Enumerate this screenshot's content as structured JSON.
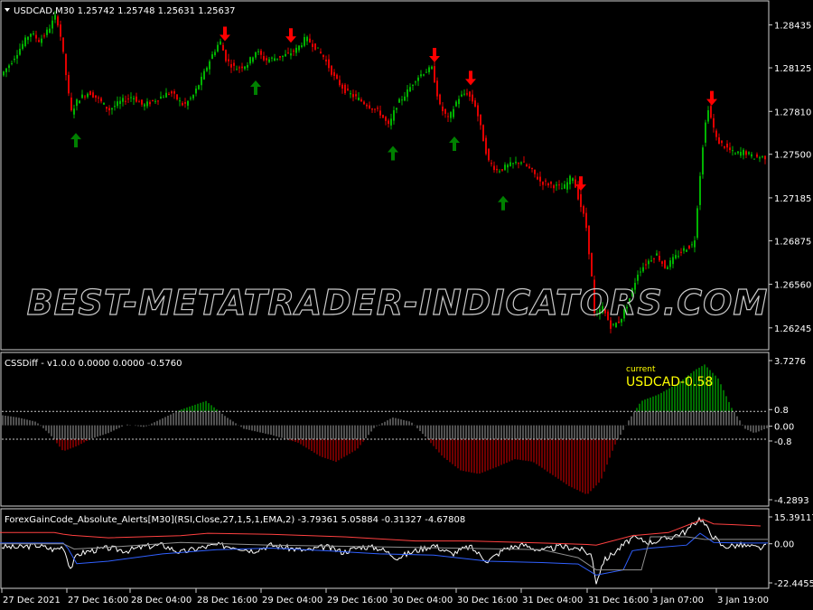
{
  "main_panel": {
    "symbol_header": "USDCAD,M30  1.25742 1.25748 1.25631 1.25637",
    "price_ticks": [
      "1.28435",
      "1.28125",
      "1.27810",
      "1.27500",
      "1.27185",
      "1.26875",
      "1.26560",
      "1.26245"
    ],
    "watermark": "BEST-METATRADER-INDICATORS.COM"
  },
  "cssdiff_panel": {
    "header": "CSSDiff - v1.0.0 0.0000 0.0000 -0.5760",
    "ticks": [
      "3.7276",
      "0.8",
      "0.00",
      "-0.8",
      "-4.2893"
    ],
    "current_caption": "current",
    "current_value": "USDCAD-0.58"
  },
  "alerts_panel": {
    "header": "ForexGainCode_Absolute_Alerts[M30](RSI,Close,27,1,5,1,EMA,2) -3.79361 5.05884 -0.31327 -4.67808",
    "ticks": [
      "15.39117",
      "0.00",
      "-22.4455"
    ]
  },
  "time_axis": [
    "27 Dec 2021",
    "27 Dec 16:00",
    "28 Dec 04:00",
    "28 Dec 16:00",
    "29 Dec 04:00",
    "29 Dec 16:00",
    "30 Dec 04:00",
    "30 Dec 16:00",
    "31 Dec 04:00",
    "31 Dec 16:00",
    "3 Jan 07:00",
    "3 Jan 19:00"
  ],
  "colors": {
    "bull": "#00b300",
    "bear": "#e00000",
    "up_arrow": "#008000",
    "down_arrow": "#ff0000",
    "hist_grey": "#a0a0a0",
    "hist_green": "#00dd00",
    "hist_red": "#dd0000",
    "caption": "#ffff00"
  },
  "chart_data": [
    {
      "type": "candlestick",
      "title": "USDCAD,M30",
      "ylim": [
        1.261,
        1.2855
      ],
      "price_path": [
        [
          0,
          1.2805
        ],
        [
          12,
          1.2815
        ],
        [
          22,
          1.2825
        ],
        [
          35,
          1.2838
        ],
        [
          45,
          1.2832
        ],
        [
          55,
          1.284
        ],
        [
          63,
          1.285
        ],
        [
          67,
          1.2842
        ],
        [
          72,
          1.282
        ],
        [
          80,
          1.278
        ],
        [
          88,
          1.279
        ],
        [
          100,
          1.2795
        ],
        [
          110,
          1.279
        ],
        [
          122,
          1.2782
        ],
        [
          135,
          1.2788
        ],
        [
          148,
          1.2792
        ],
        [
          160,
          1.2785
        ],
        [
          175,
          1.279
        ],
        [
          190,
          1.2795
        ],
        [
          205,
          1.2785
        ],
        [
          215,
          1.2792
        ],
        [
          225,
          1.2805
        ],
        [
          235,
          1.282
        ],
        [
          245,
          1.2832
        ],
        [
          252,
          1.2818
        ],
        [
          262,
          1.2812
        ],
        [
          275,
          1.2815
        ],
        [
          285,
          1.2825
        ],
        [
          295,
          1.2818
        ],
        [
          308,
          1.282
        ],
        [
          320,
          1.2822
        ],
        [
          330,
          1.2826
        ],
        [
          340,
          1.2834
        ],
        [
          350,
          1.2828
        ],
        [
          360,
          1.282
        ],
        [
          372,
          1.2805
        ],
        [
          385,
          1.2795
        ],
        [
          398,
          1.279
        ],
        [
          410,
          1.2785
        ],
        [
          422,
          1.278
        ],
        [
          432,
          1.277
        ],
        [
          440,
          1.2785
        ],
        [
          452,
          1.2795
        ],
        [
          462,
          1.2805
        ],
        [
          472,
          1.281
        ],
        [
          480,
          1.2812
        ],
        [
          488,
          1.2785
        ],
        [
          498,
          1.2775
        ],
        [
          508,
          1.279
        ],
        [
          518,
          1.2795
        ],
        [
          528,
          1.2785
        ],
        [
          535,
          1.2765
        ],
        [
          542,
          1.2745
        ],
        [
          552,
          1.2738
        ],
        [
          565,
          1.2742
        ],
        [
          578,
          1.2745
        ],
        [
          590,
          1.2738
        ],
        [
          600,
          1.273
        ],
        [
          612,
          1.2728
        ],
        [
          625,
          1.2725
        ],
        [
          635,
          1.2735
        ],
        [
          642,
          1.2718
        ],
        [
          650,
          1.27
        ],
        [
          656,
          1.2665
        ],
        [
          660,
          1.263
        ],
        [
          668,
          1.264
        ],
        [
          678,
          1.2625
        ],
        [
          688,
          1.263
        ],
        [
          698,
          1.2645
        ],
        [
          708,
          1.2665
        ],
        [
          718,
          1.2672
        ],
        [
          728,
          1.2678
        ],
        [
          738,
          1.2668
        ],
        [
          748,
          1.2675
        ],
        [
          760,
          1.2682
        ],
        [
          770,
          1.2685
        ],
        [
          775,
          1.2725
        ],
        [
          780,
          1.276
        ],
        [
          785,
          1.2785
        ],
        [
          795,
          1.276
        ],
        [
          805,
          1.2755
        ],
        [
          815,
          1.275
        ],
        [
          825,
          1.2752
        ],
        [
          835,
          1.2748
        ],
        [
          848,
          1.2748
        ]
      ],
      "buy_arrows_at": [
        84,
        283,
        435,
        503,
        557
      ],
      "sell_arrows_at": [
        249,
        322,
        481,
        521,
        643,
        788
      ]
    },
    {
      "type": "histogram",
      "title": "CSSDiff - v1.0.0",
      "ylim": [
        -4.2893,
        3.7276
      ],
      "levels": [
        0.8,
        -0.8
      ],
      "value_path": [
        [
          0,
          0.6
        ],
        [
          20,
          0.45
        ],
        [
          40,
          0.2
        ],
        [
          55,
          -0.5
        ],
        [
          70,
          -1.5
        ],
        [
          85,
          -1.2
        ],
        [
          100,
          -0.8
        ],
        [
          120,
          -0.45
        ],
        [
          140,
          0.05
        ],
        [
          160,
          -0.1
        ],
        [
          180,
          0.4
        ],
        [
          200,
          0.9
        ],
        [
          228,
          1.4
        ],
        [
          250,
          0.5
        ],
        [
          270,
          -0.2
        ],
        [
          300,
          -0.55
        ],
        [
          330,
          -1.0
        ],
        [
          355,
          -1.8
        ],
        [
          372,
          -2.1
        ],
        [
          395,
          -1.4
        ],
        [
          415,
          -0.1
        ],
        [
          435,
          0.45
        ],
        [
          455,
          0.2
        ],
        [
          470,
          -0.6
        ],
        [
          490,
          -1.8
        ],
        [
          510,
          -2.6
        ],
        [
          530,
          -2.8
        ],
        [
          550,
          -2.4
        ],
        [
          570,
          -1.95
        ],
        [
          590,
          -2.1
        ],
        [
          610,
          -2.8
        ],
        [
          630,
          -3.5
        ],
        [
          650,
          -4.0
        ],
        [
          665,
          -3.2
        ],
        [
          680,
          -1.2
        ],
        [
          695,
          0.2
        ],
        [
          710,
          1.4
        ],
        [
          730,
          1.8
        ],
        [
          750,
          2.4
        ],
        [
          770,
          3.2
        ],
        [
          780,
          3.5
        ],
        [
          795,
          2.7
        ],
        [
          810,
          1.0
        ],
        [
          825,
          -0.2
        ],
        [
          835,
          -0.45
        ],
        [
          850,
          -0.15
        ]
      ]
    },
    {
      "type": "line",
      "title": "ForexGainCode_Absolute_Alerts[M30]",
      "ylim": [
        -22.4455,
        15.39117
      ],
      "series": [
        {
          "color": "#ffffff",
          "values": [
            [
              0,
              -1.6
            ],
            [
              20,
              -2.2
            ],
            [
              40,
              -0.8
            ],
            [
              60,
              -3.4
            ],
            [
              70,
              -1.5
            ],
            [
              78,
              -14.0
            ],
            [
              86,
              -6.0
            ],
            [
              100,
              -4.0
            ],
            [
              120,
              -2.5
            ],
            [
              140,
              -4.0
            ],
            [
              160,
              -1.6
            ],
            [
              180,
              -0.8
            ],
            [
              200,
              -5.0
            ],
            [
              220,
              -2.5
            ],
            [
              240,
              -0.8
            ],
            [
              260,
              -1.6
            ],
            [
              280,
              -4.0
            ],
            [
              300,
              -0.8
            ],
            [
              320,
              -2.5
            ],
            [
              340,
              -4.0
            ],
            [
              360,
              -1.6
            ],
            [
              380,
              -4.8
            ],
            [
              400,
              -1.6
            ],
            [
              420,
              -2.5
            ],
            [
              440,
              -8.0
            ],
            [
              460,
              -4.0
            ],
            [
              480,
              -0.8
            ],
            [
              500,
              -5.8
            ],
            [
              520,
              -1.6
            ],
            [
              540,
              -10.0
            ],
            [
              560,
              -2.5
            ],
            [
              580,
              -0.8
            ],
            [
              600,
              -4.0
            ],
            [
              620,
              -1.6
            ],
            [
              640,
              -2.5
            ],
            [
              655,
              -6.5
            ],
            [
              660,
              -22.0
            ],
            [
              668,
              -10.0
            ],
            [
              680,
              -5.0
            ],
            [
              690,
              -0.8
            ],
            [
              700,
              3.4
            ],
            [
              720,
              0.8
            ],
            [
              740,
              3.4
            ],
            [
              760,
              7.2
            ],
            [
              775,
              15.0
            ],
            [
              785,
              7.2
            ],
            [
              800,
              -1.6
            ],
            [
              820,
              -0.8
            ],
            [
              840,
              -2.5
            ],
            [
              850,
              -1.6
            ]
          ]
        },
        {
          "color": "#ff4040",
          "values": [
            [
              0,
              6.4
            ],
            [
              60,
              6.4
            ],
            [
              70,
              5.5
            ],
            [
              80,
              4.8
            ],
            [
              120,
              3.4
            ],
            [
              200,
              4.6
            ],
            [
              230,
              6.0
            ],
            [
              300,
              5.4
            ],
            [
              380,
              4.0
            ],
            [
              460,
              1.6
            ],
            [
              520,
              1.6
            ],
            [
              600,
              0.4
            ],
            [
              650,
              -0.4
            ],
            [
              660,
              -0.8
            ],
            [
              700,
              4.6
            ],
            [
              740,
              6.4
            ],
            [
              778,
              14.0
            ],
            [
              790,
              11.4
            ],
            [
              810,
              11.0
            ],
            [
              842,
              10.2
            ]
          ]
        },
        {
          "color": "#3060ff",
          "values": [
            [
              0,
              0.4
            ],
            [
              70,
              0.4
            ],
            [
              75,
              -2.5
            ],
            [
              85,
              -11.4
            ],
            [
              120,
              -10.0
            ],
            [
              180,
              -5.8
            ],
            [
              240,
              -3.4
            ],
            [
              300,
              -2.5
            ],
            [
              360,
              -4.0
            ],
            [
              420,
              -5.8
            ],
            [
              480,
              -6.5
            ],
            [
              540,
              -10.0
            ],
            [
              600,
              -10.8
            ],
            [
              640,
              -11.6
            ],
            [
              660,
              -18.0
            ],
            [
              690,
              -15.0
            ],
            [
              700,
              -4.0
            ],
            [
              720,
              -2.5
            ],
            [
              760,
              -0.8
            ],
            [
              775,
              6.0
            ],
            [
              790,
              0.8
            ],
            [
              820,
              0.4
            ],
            [
              850,
              0.4
            ]
          ]
        },
        {
          "color": "#909090",
          "values": [
            [
              0,
              0.0
            ],
            [
              70,
              0.0
            ],
            [
              82,
              -3.0
            ],
            [
              120,
              -2.0
            ],
            [
              200,
              0.8
            ],
            [
              300,
              -0.8
            ],
            [
              400,
              -1.6
            ],
            [
              500,
              -2.5
            ],
            [
              600,
              -3.4
            ],
            [
              640,
              -8.0
            ],
            [
              660,
              -15.0
            ],
            [
              710,
              -15.0
            ],
            [
              720,
              4.0
            ],
            [
              760,
              4.0
            ],
            [
              780,
              2.5
            ],
            [
              850,
              2.5
            ]
          ]
        }
      ]
    }
  ]
}
